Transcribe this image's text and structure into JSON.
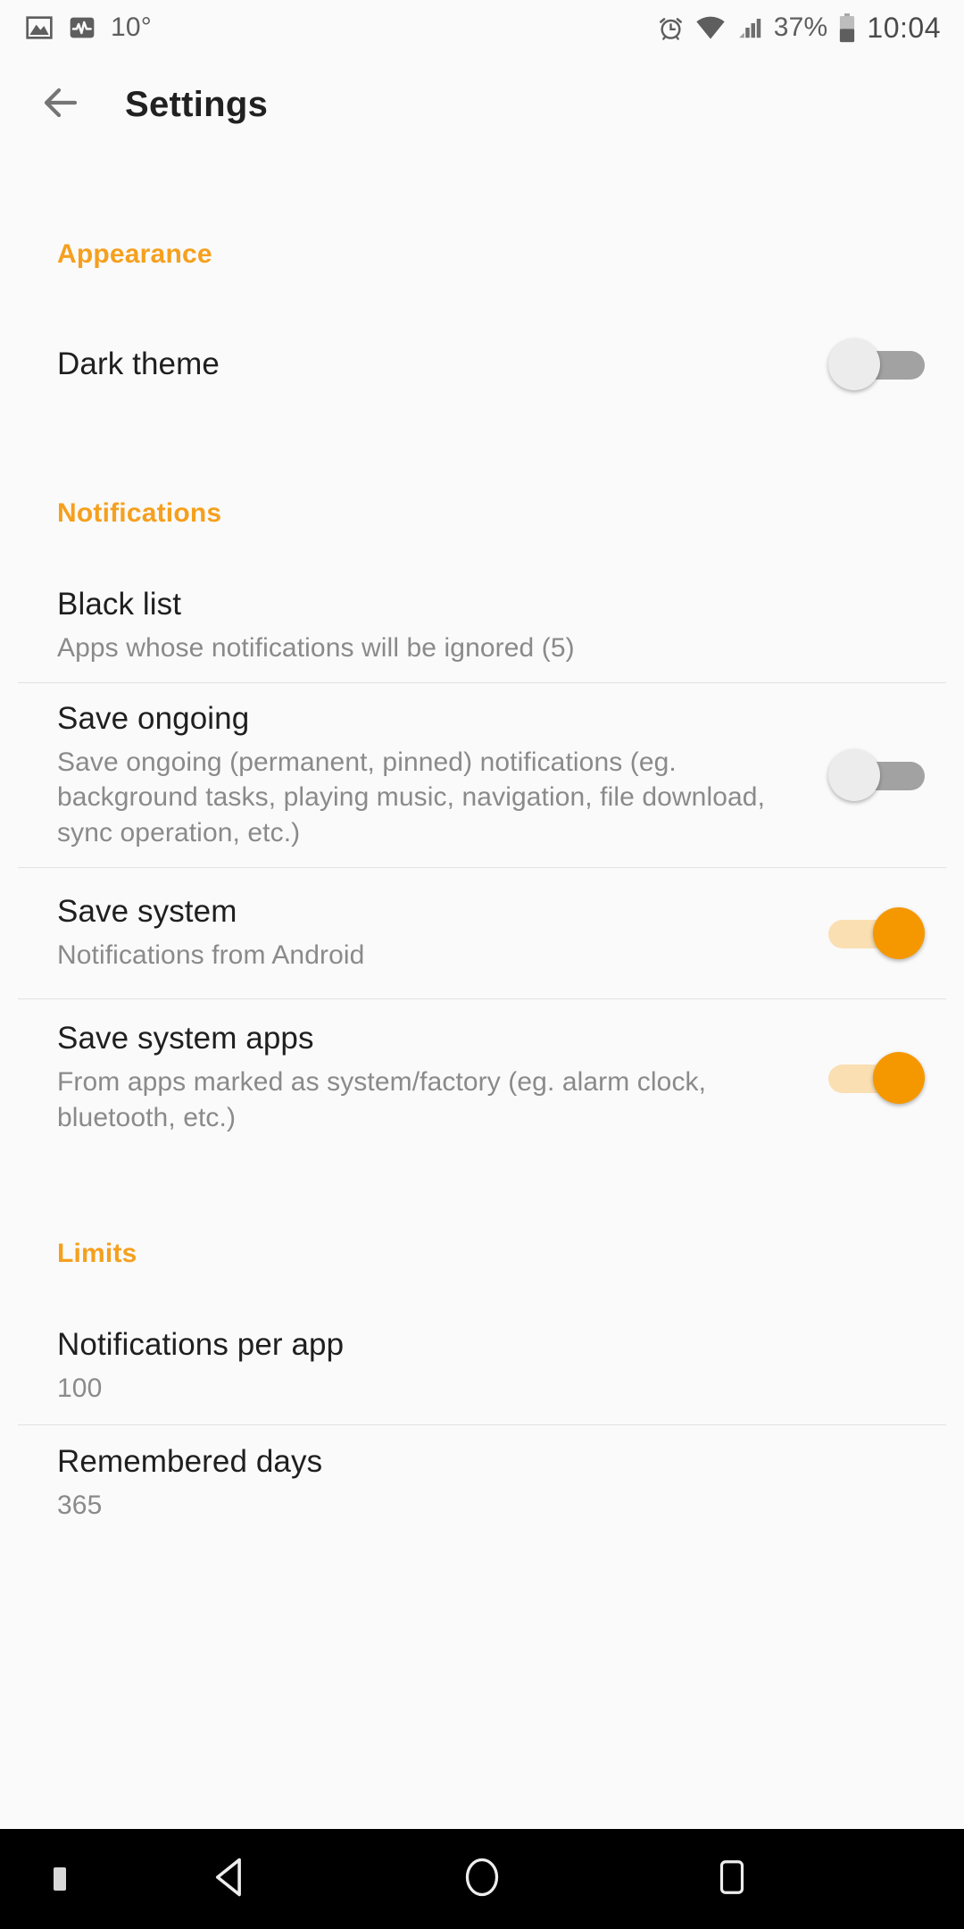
{
  "statusbar": {
    "left_icons": [
      {
        "name": "image-icon"
      },
      {
        "name": "pulse-icon"
      }
    ],
    "temperature": "10°",
    "right_icons": [
      {
        "name": "alarm-icon"
      },
      {
        "name": "wifi-icon"
      },
      {
        "name": "signal-icon"
      }
    ],
    "battery_percent": "37%",
    "clock": "10:04"
  },
  "appbar": {
    "back_icon": "arrow-left-icon",
    "title": "Settings"
  },
  "sections": {
    "appearance": {
      "header": "Appearance",
      "dark_theme": {
        "title": "Dark theme",
        "toggle": "off"
      }
    },
    "notifications": {
      "header": "Notifications",
      "black_list": {
        "title": "Black list",
        "subtitle": "Apps whose notifications will be ignored (5)"
      },
      "save_ongoing": {
        "title": "Save ongoing",
        "subtitle": "Save ongoing (permanent, pinned) notifications (eg. background tasks, playing music, navigation, file download, sync operation, etc.)",
        "toggle": "off"
      },
      "save_system": {
        "title": "Save system",
        "subtitle": "Notifications from Android",
        "toggle": "on"
      },
      "save_system_apps": {
        "title": "Save system apps",
        "subtitle": "From apps marked as system/factory (eg. alarm clock, bluetooth, etc.)",
        "toggle": "on"
      }
    },
    "limits": {
      "header": "Limits",
      "notifications_per_app": {
        "title": "Notifications per app",
        "value": "100"
      },
      "remembered_days": {
        "title": "Remembered days",
        "value": "365"
      }
    }
  },
  "navbar": {
    "back": "back-nav-button",
    "home": "home-nav-button",
    "recents": "recents-nav-button"
  },
  "colors": {
    "accent": "#F5A01E",
    "background": "#FAFAFA",
    "primary_text": "#1F1F1F",
    "secondary_text": "#8A8A8A",
    "toggle_on_thumb": "#F59800",
    "toggle_on_track": "#FADFB3",
    "toggle_off_thumb": "#ECECEC",
    "toggle_off_track": "#A2A2A2"
  }
}
